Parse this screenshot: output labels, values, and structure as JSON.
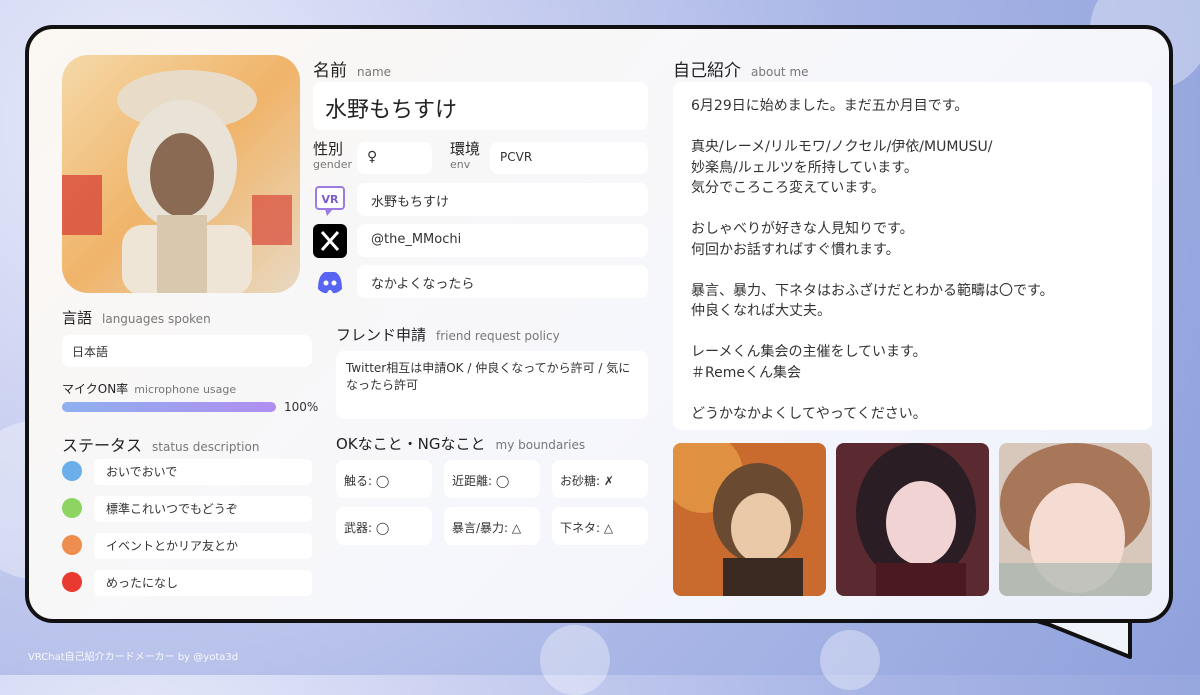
{
  "name_section": {
    "label": "名前",
    "sub": "name",
    "value": "水野もちすけ"
  },
  "gender": {
    "label": "性別",
    "sub": "gender",
    "value": "♀"
  },
  "env": {
    "label": "環境",
    "sub": "env",
    "value": "PCVR"
  },
  "accounts": {
    "vrchat": {
      "icon": "vrchat-icon",
      "value": "水野もちすけ"
    },
    "x": {
      "icon": "x-icon",
      "value": "@the_MMochi"
    },
    "discord": {
      "icon": "discord-icon",
      "value": "なかよくなったら"
    }
  },
  "friend_request": {
    "label": "フレンド申請",
    "sub": "friend request policy",
    "value": "Twitter相互は申請OK / 仲良くなってから許可 / 気になったら許可"
  },
  "boundaries": {
    "label": "OKなこと・NGなこと",
    "sub": "my boundaries",
    "items": [
      "触る: ◯",
      "近距離: ◯",
      "お砂糖: ✗",
      "武器: ◯",
      "暴言/暴力: △",
      "下ネタ: △"
    ]
  },
  "languages": {
    "label": "言語",
    "sub": "languages spoken",
    "value": "日本語"
  },
  "mic": {
    "label": "マイクON率",
    "sub": "microphone usage",
    "value": "100%",
    "fraction": 1.0
  },
  "status": {
    "label": "ステータス",
    "sub": "status description",
    "items": [
      {
        "color": "#6aaeea",
        "text": "おいでおいで"
      },
      {
        "color": "#8dd463",
        "text": "標準これいつでもどうぞ"
      },
      {
        "color": "#ee8e4e",
        "text": "イベントとかリア友とか"
      },
      {
        "color": "#e83a2e",
        "text": "めったになし"
      }
    ]
  },
  "about": {
    "label": "自己紹介",
    "sub": "about me",
    "lines": [
      "6月29日に始めました。まだ五か月目です。",
      "",
      "真央/レーメ/リルモワ/ノクセル/伊依/MUMUSU/",
      "妙楽鳥/ルェルツを所持しています。",
      "気分でころころ変えています。",
      "",
      "おしゃべりが好きな人見知りです。",
      "何回かお話すればすぐ慣れます。",
      "",
      "暴言、暴力、下ネタはおふざけだとわかる範疇は〇です。",
      "仲良くなれば大丈夫。",
      "",
      "レーメくん集会の主催をしています。",
      "＃Remeくん集会",
      "",
      "どうかなかよくしてやってください。"
    ]
  },
  "footer": "VRChat自己紹介カードメーカー by @yota3d",
  "colors": {
    "accent": "#8fb0f0",
    "accent2": "#b08ef0",
    "border": "#111111"
  }
}
